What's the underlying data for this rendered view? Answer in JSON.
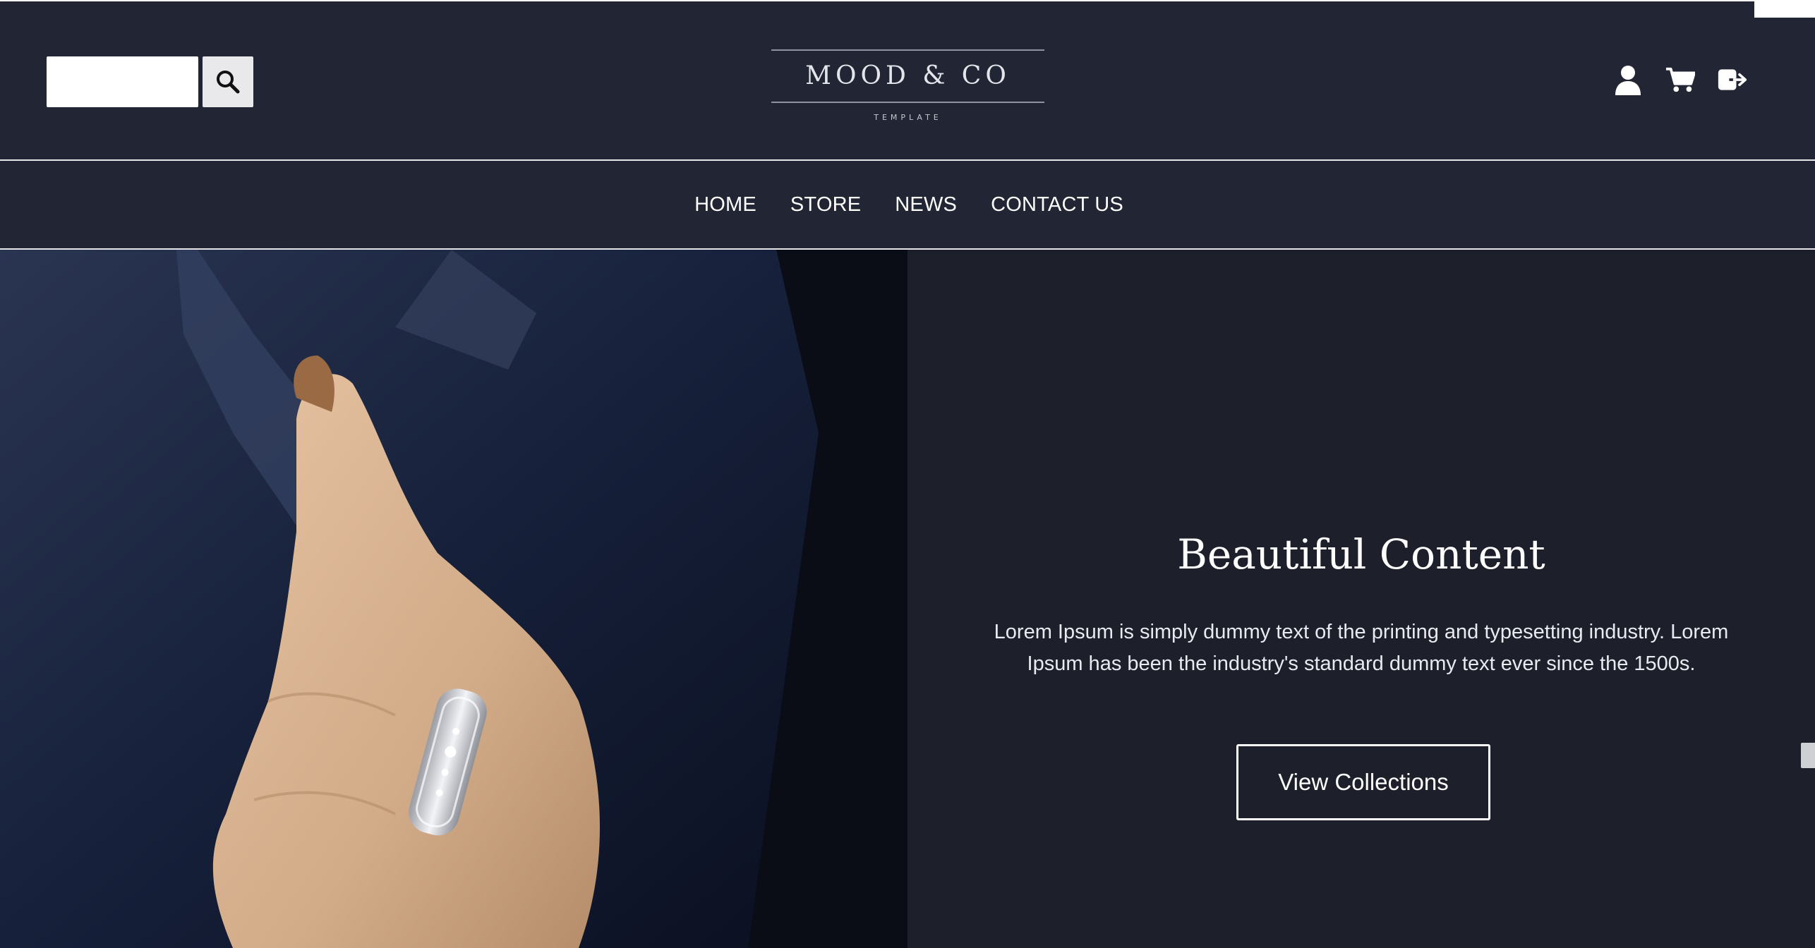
{
  "header": {
    "search": {
      "placeholder": "",
      "value": "",
      "button_icon": "search-icon"
    },
    "logo": {
      "name": "MOOD & CO",
      "tagline": "TEMPLATE"
    },
    "icons": [
      "user-icon",
      "cart-icon",
      "logout-icon"
    ]
  },
  "nav": {
    "items": [
      {
        "label": "HOME"
      },
      {
        "label": "STORE"
      },
      {
        "label": "NEWS"
      },
      {
        "label": "CONTACT US"
      }
    ]
  },
  "hero": {
    "title": "Beautiful Content",
    "text": "Lorem Ipsum is simply dummy text of the printing and typesetting industry. Lorem Ipsum has been the industry's standard dummy text ever since the 1500s.",
    "cta_label": "View Collections"
  },
  "colors": {
    "header_bg": "#222634",
    "content_bg": "#1d202b",
    "text": "#ffffff",
    "divider": "#e6e6e9"
  }
}
